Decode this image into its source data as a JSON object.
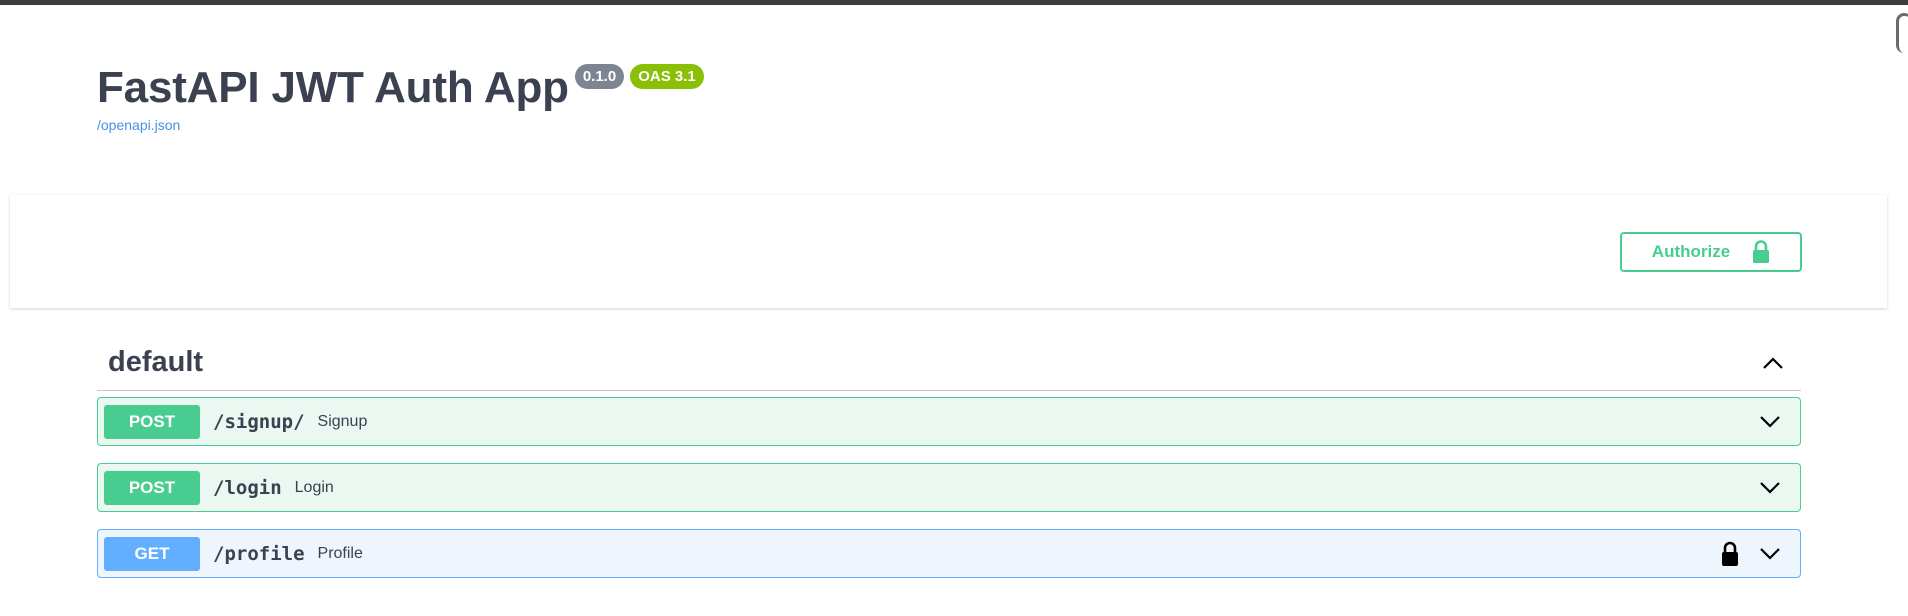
{
  "info": {
    "title": "FastAPI JWT Auth App",
    "version": "0.1.0",
    "oas_version": "OAS 3.1",
    "spec_link": "/openapi.json"
  },
  "auth": {
    "authorize_label": "Authorize"
  },
  "tag": {
    "name": "default"
  },
  "operations": [
    {
      "method": "POST",
      "path": "/signup/",
      "summary": "Signup",
      "locked": false
    },
    {
      "method": "POST",
      "path": "/login",
      "summary": "Login",
      "locked": false
    },
    {
      "method": "GET",
      "path": "/profile",
      "summary": "Profile",
      "locked": true
    }
  ],
  "colors": {
    "post": "#49cc90",
    "get": "#61affe",
    "version_badge": "#7d8492",
    "oas_badge": "#89bf04",
    "link": "#4990e2"
  },
  "icons": {
    "authorize": "lock-icon",
    "collapse_tag": "chevron-up-icon",
    "expand_op": "chevron-down-icon",
    "op_lock": "lock-icon"
  }
}
